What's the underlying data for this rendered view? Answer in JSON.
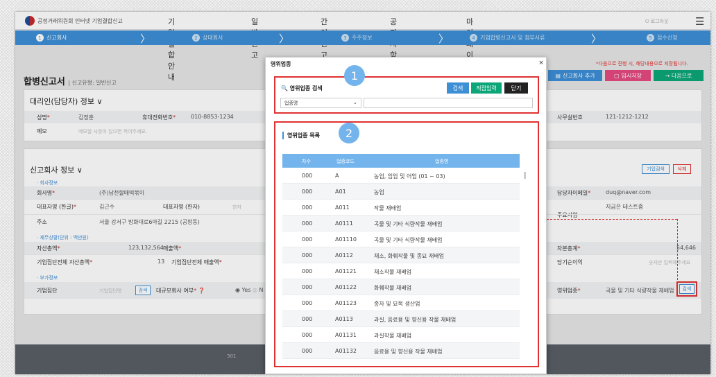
{
  "header": {
    "logo": "공정거래위원회 인터넷 기업결합신고",
    "nav": [
      "기업결합안내",
      "일반신고",
      "간이신고",
      "공지사항",
      "마이페이지"
    ],
    "login": "로그아웃"
  },
  "steps": [
    {
      "num": "1",
      "label": "신고회사"
    },
    {
      "num": "2",
      "label": "상대회사"
    },
    {
      "num": "3",
      "label": "주주정보"
    },
    {
      "num": "4",
      "label": "기업합병신고서 및 첨부서류"
    },
    {
      "num": "5",
      "label": "접수신청"
    }
  ],
  "page": {
    "title": "합병신고서",
    "sub": "| 신고유형: 일반신고",
    "notice": "*다음으로 진행 시, 해당내용으로 저장됩니다.",
    "btn_add": "신고회사 추가",
    "btn_save": "임시저장",
    "btn_next": "→ 다음으로"
  },
  "agent": {
    "title": "대리인(담당자) 정보 ∨",
    "name_label": "성명",
    "name": "김정훈",
    "phone_label": "휴대전화번호",
    "phone": "010-8853-1234",
    "office_label": "사무실번호",
    "office": "121-1212-1212",
    "memo_label": "메모",
    "memo_ph": "메모할 사항이 있으면 적어주세요."
  },
  "company": {
    "title": "신고회사 정보 ∨",
    "btn_search": "기업검색",
    "btn_delete": "삭제",
    "sub_info": "· 회사정보",
    "name_label": "회사명",
    "name": "(주)남천할매떡볶이",
    "rep_kr_label": "대표자명 (한글)",
    "rep_kr": "김근수",
    "rep_hanja_label": "대표자명 (한자)",
    "rep_hanja_ph": "한자",
    "addr_label": "주소",
    "addr": "서울 강서구 방화대로6마길 2215 (공항동)",
    "email_label": "담당자이메일",
    "email": "duq@naver.com",
    "main_biz_label": "주요사업",
    "main_biz": "지금은 테스트중",
    "sub_fin": "· 재무상황(단위 : 백만원)",
    "assets_label": "자산총액",
    "assets": "123,132,564",
    "sales_label": "매출액",
    "group_assets_label": "기업집단전체 자산총액",
    "group_assets": "13",
    "group_sales_label": "기업집단전체 매출액",
    "capital_label": "자본총계",
    "capital": "54,646",
    "profit_label": "당기순이익",
    "profit_ph": "숫자만 입력해주세요",
    "sub_extra": "· 부가정보",
    "group_label": "기업집단",
    "group_ph": "기업집단명",
    "group_btn": "검색",
    "large_label": "대규모회사 여부",
    "yes": "Yes",
    "no": "N",
    "biz_label": "영위업종",
    "biz": "곡물 및 기타 식량작물 재배업",
    "biz_btn": "검색"
  },
  "footer": "301",
  "modal": {
    "title": "영위업종",
    "close": "×",
    "search_title": "영위업종 검색",
    "btn_search": "검색",
    "btn_direct": "직접입력",
    "btn_close": "닫기",
    "select": "업종명",
    "list_title": "영위업종 목록",
    "badge1": "1",
    "badge2": "2",
    "cols": [
      "차수",
      "업종코드",
      "업종명"
    ],
    "rows": [
      [
        "000",
        "A",
        "농업, 임업 및 어업 (01 ~ 03)"
      ],
      [
        "000",
        "A01",
        "농업"
      ],
      [
        "000",
        "A011",
        "작물 재배업"
      ],
      [
        "000",
        "A0111",
        "곡물 및 기타 식량작물 재배업"
      ],
      [
        "000",
        "A01110",
        "곡물 및 기타 식량작물 재배업"
      ],
      [
        "000",
        "A0112",
        "채소, 화훼작물 및 종묘 재배업"
      ],
      [
        "000",
        "A01121",
        "채소작물 재배업"
      ],
      [
        "000",
        "A01122",
        "화훼작물 재배업"
      ],
      [
        "000",
        "A01123",
        "종자 및 묘목 생산업"
      ],
      [
        "000",
        "A0113",
        "과실, 음료용 및 향신용 작물 재배업"
      ],
      [
        "000",
        "A01131",
        "과실작물 재배업"
      ],
      [
        "000",
        "A01132",
        "음료용 및 향신용 작물 재배업"
      ]
    ]
  },
  "colors": {
    "accent": "#3d8fd6",
    "highlight": "#e03131",
    "table_header": "#74b4ec"
  }
}
